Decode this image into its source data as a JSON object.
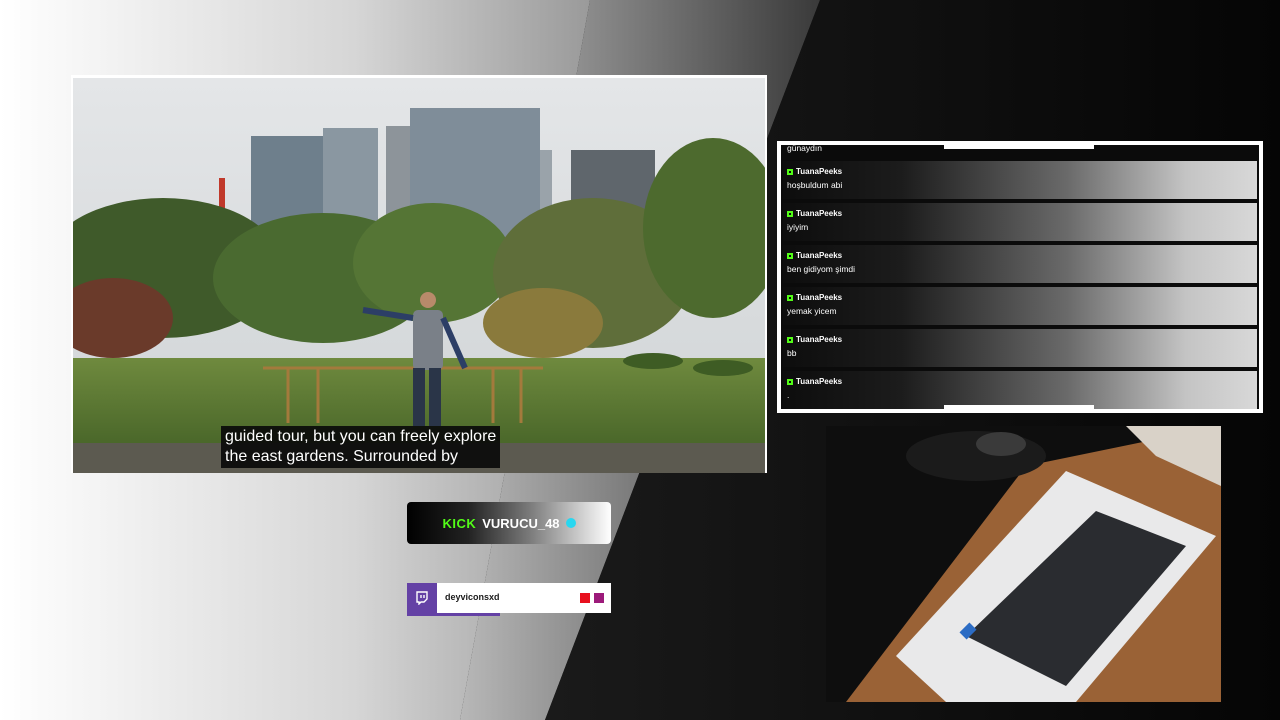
{
  "video": {
    "subtitle_line1": "guided tour, but you can freely explore",
    "subtitle_line2": "the east gardens. Surrounded by"
  },
  "chat": {
    "partial_top_text": "günaydın",
    "messages": [
      {
        "user": "TuanaPeeks",
        "text": "hoşbuldum abi"
      },
      {
        "user": "TuanaPeeks",
        "text": "iyiyim"
      },
      {
        "user": "TuanaPeeks",
        "text": "ben gidiyom şimdi"
      },
      {
        "user": "TuanaPeeks",
        "text": "yemak yicem"
      },
      {
        "user": "TuanaPeeks",
        "text": "bb"
      },
      {
        "user": "TuanaPeeks",
        "text": "."
      }
    ]
  },
  "kick": {
    "logo": "KICK",
    "username": "VURUCU_48",
    "accent": "#53fc18",
    "verified_icon": "verified-dot-icon"
  },
  "twitch": {
    "username": "deyviconsxd",
    "accent": "#6441a5",
    "icon": "twitch-icon"
  }
}
